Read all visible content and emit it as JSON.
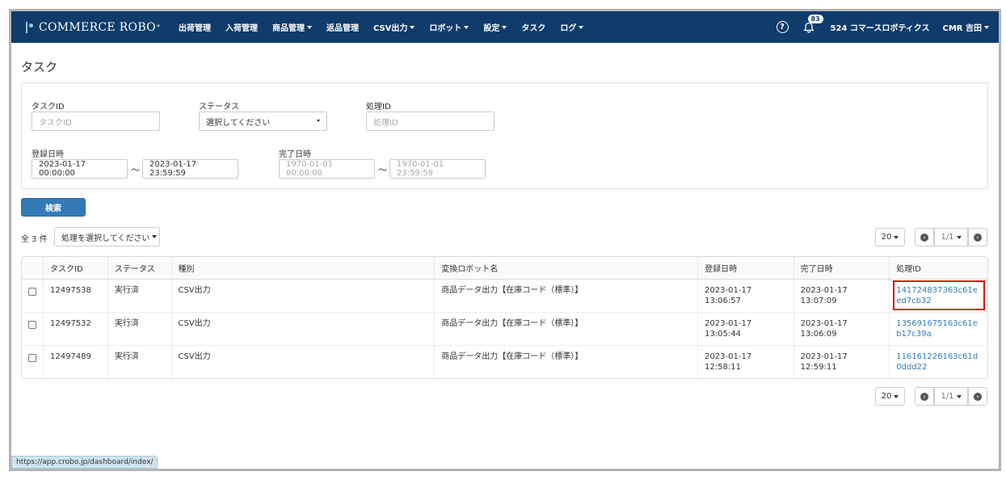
{
  "navbar": {
    "brand": "COMMERCE ROBO",
    "items": [
      {
        "label": "出荷管理",
        "dropdown": false
      },
      {
        "label": "入荷管理",
        "dropdown": false
      },
      {
        "label": "商品管理",
        "dropdown": true
      },
      {
        "label": "返品管理",
        "dropdown": false
      },
      {
        "label": "CSV出力",
        "dropdown": true
      },
      {
        "label": "ロボット",
        "dropdown": true
      },
      {
        "label": "設定",
        "dropdown": true
      },
      {
        "label": "タスク",
        "dropdown": false
      },
      {
        "label": "ログ",
        "dropdown": true
      }
    ],
    "notification_count": "83",
    "company": "524 コマースロボティクス",
    "user": "CMR 吉田"
  },
  "page": {
    "title": "タスク"
  },
  "filters": {
    "task_id": {
      "label": "タスクID",
      "placeholder": "タスクID",
      "value": ""
    },
    "status": {
      "label": "ステータス",
      "value": "選択してください"
    },
    "process_id": {
      "label": "処理ID",
      "placeholder": "処理ID",
      "value": ""
    },
    "registered": {
      "label": "登録日時",
      "from": "2023-01-17 00:00:00",
      "to": "2023-01-17 23:59:59"
    },
    "completed": {
      "label": "完了日時",
      "from_placeholder": "1970-01-01 00:00:00",
      "to_placeholder": "1970-01-01 23:59:59"
    },
    "tilde": "〜",
    "search_button": "検索"
  },
  "list": {
    "count_label": "全 3 件",
    "bulk_action": "処理を選択してください",
    "per_page": "20",
    "page_indicator": "1/1",
    "columns": [
      "タスクID",
      "ステータス",
      "種別",
      "変換ロボット名",
      "登録日時",
      "完了日時",
      "処理ID"
    ],
    "rows": [
      {
        "task_id": "12497538",
        "status": "実行済",
        "type": "CSV出力",
        "robot": "商品データ出力【在庫コード（標準）】",
        "registered": "2023-01-17 13:06:57",
        "completed": "2023-01-17 13:07:09",
        "process_id": "141724837363c61eed7cb32"
      },
      {
        "task_id": "12497532",
        "status": "実行済",
        "type": "CSV出力",
        "robot": "商品データ出力【在庫コード（標準）】",
        "registered": "2023-01-17 13:05:44",
        "completed": "2023-01-17 13:06:09",
        "process_id": "135691675163c61eb17c39a"
      },
      {
        "task_id": "12497489",
        "status": "実行済",
        "type": "CSV出力",
        "robot": "商品データ出力【在庫コード（標準）】",
        "registered": "2023-01-17 12:58:11",
        "completed": "2023-01-17 12:59:11",
        "process_id": "116161226163c61d0ddd22"
      }
    ]
  },
  "statusbar": {
    "url": "https://app.crobo.jp/dashboard/index/"
  },
  "colors": {
    "navbar": "#0f3c6b",
    "primary": "#337ab7",
    "highlight": "#e01010"
  }
}
